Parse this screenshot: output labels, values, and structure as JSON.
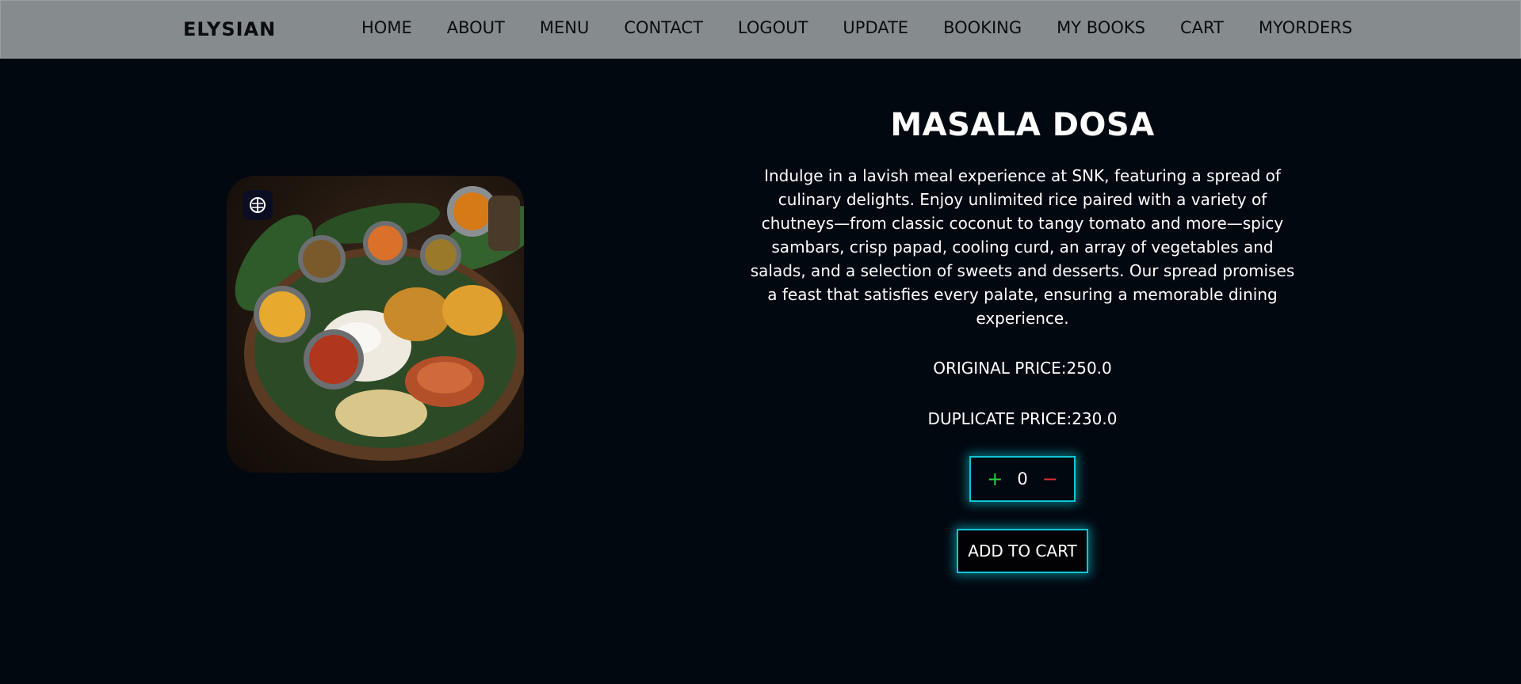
{
  "brand": "ELYSIAN",
  "nav": {
    "links": [
      {
        "label": "HOME"
      },
      {
        "label": "ABOUT"
      },
      {
        "label": "MENU"
      },
      {
        "label": "CONTACT"
      },
      {
        "label": "LOGOUT"
      },
      {
        "label": "UPDATE"
      },
      {
        "label": "BOOKING"
      },
      {
        "label": "MY BOOKS"
      },
      {
        "label": "CART"
      },
      {
        "label": "MYORDERS"
      }
    ]
  },
  "product": {
    "title": "MASALA DOSA",
    "description": "Indulge in a lavish meal experience at SNK, featuring a spread of culinary delights. Enjoy unlimited rice paired with a variety of chutneys—from classic coconut to tangy tomato and more—spicy sambars, crisp papad, cooling curd, an array of vegetables and salads, and a selection of sweets and desserts. Our spread promises a feast that satisfies every palate, ensuring a memorable dining experience.",
    "original_price": "ORIGINAL PRICE:250.0",
    "duplicate_price": "DUPLICATE PRICE:230.0",
    "image_icon": "thali-plate-image"
  },
  "quantity": {
    "plus": "+",
    "value": "0",
    "minus": "−"
  },
  "add_to_cart_label": "ADD TO CART",
  "colors": {
    "background": "#020810",
    "navbar": "#868b8e",
    "accent_glow": "#11c5d4",
    "plus": "#2ecc40",
    "minus": "#e03030"
  }
}
